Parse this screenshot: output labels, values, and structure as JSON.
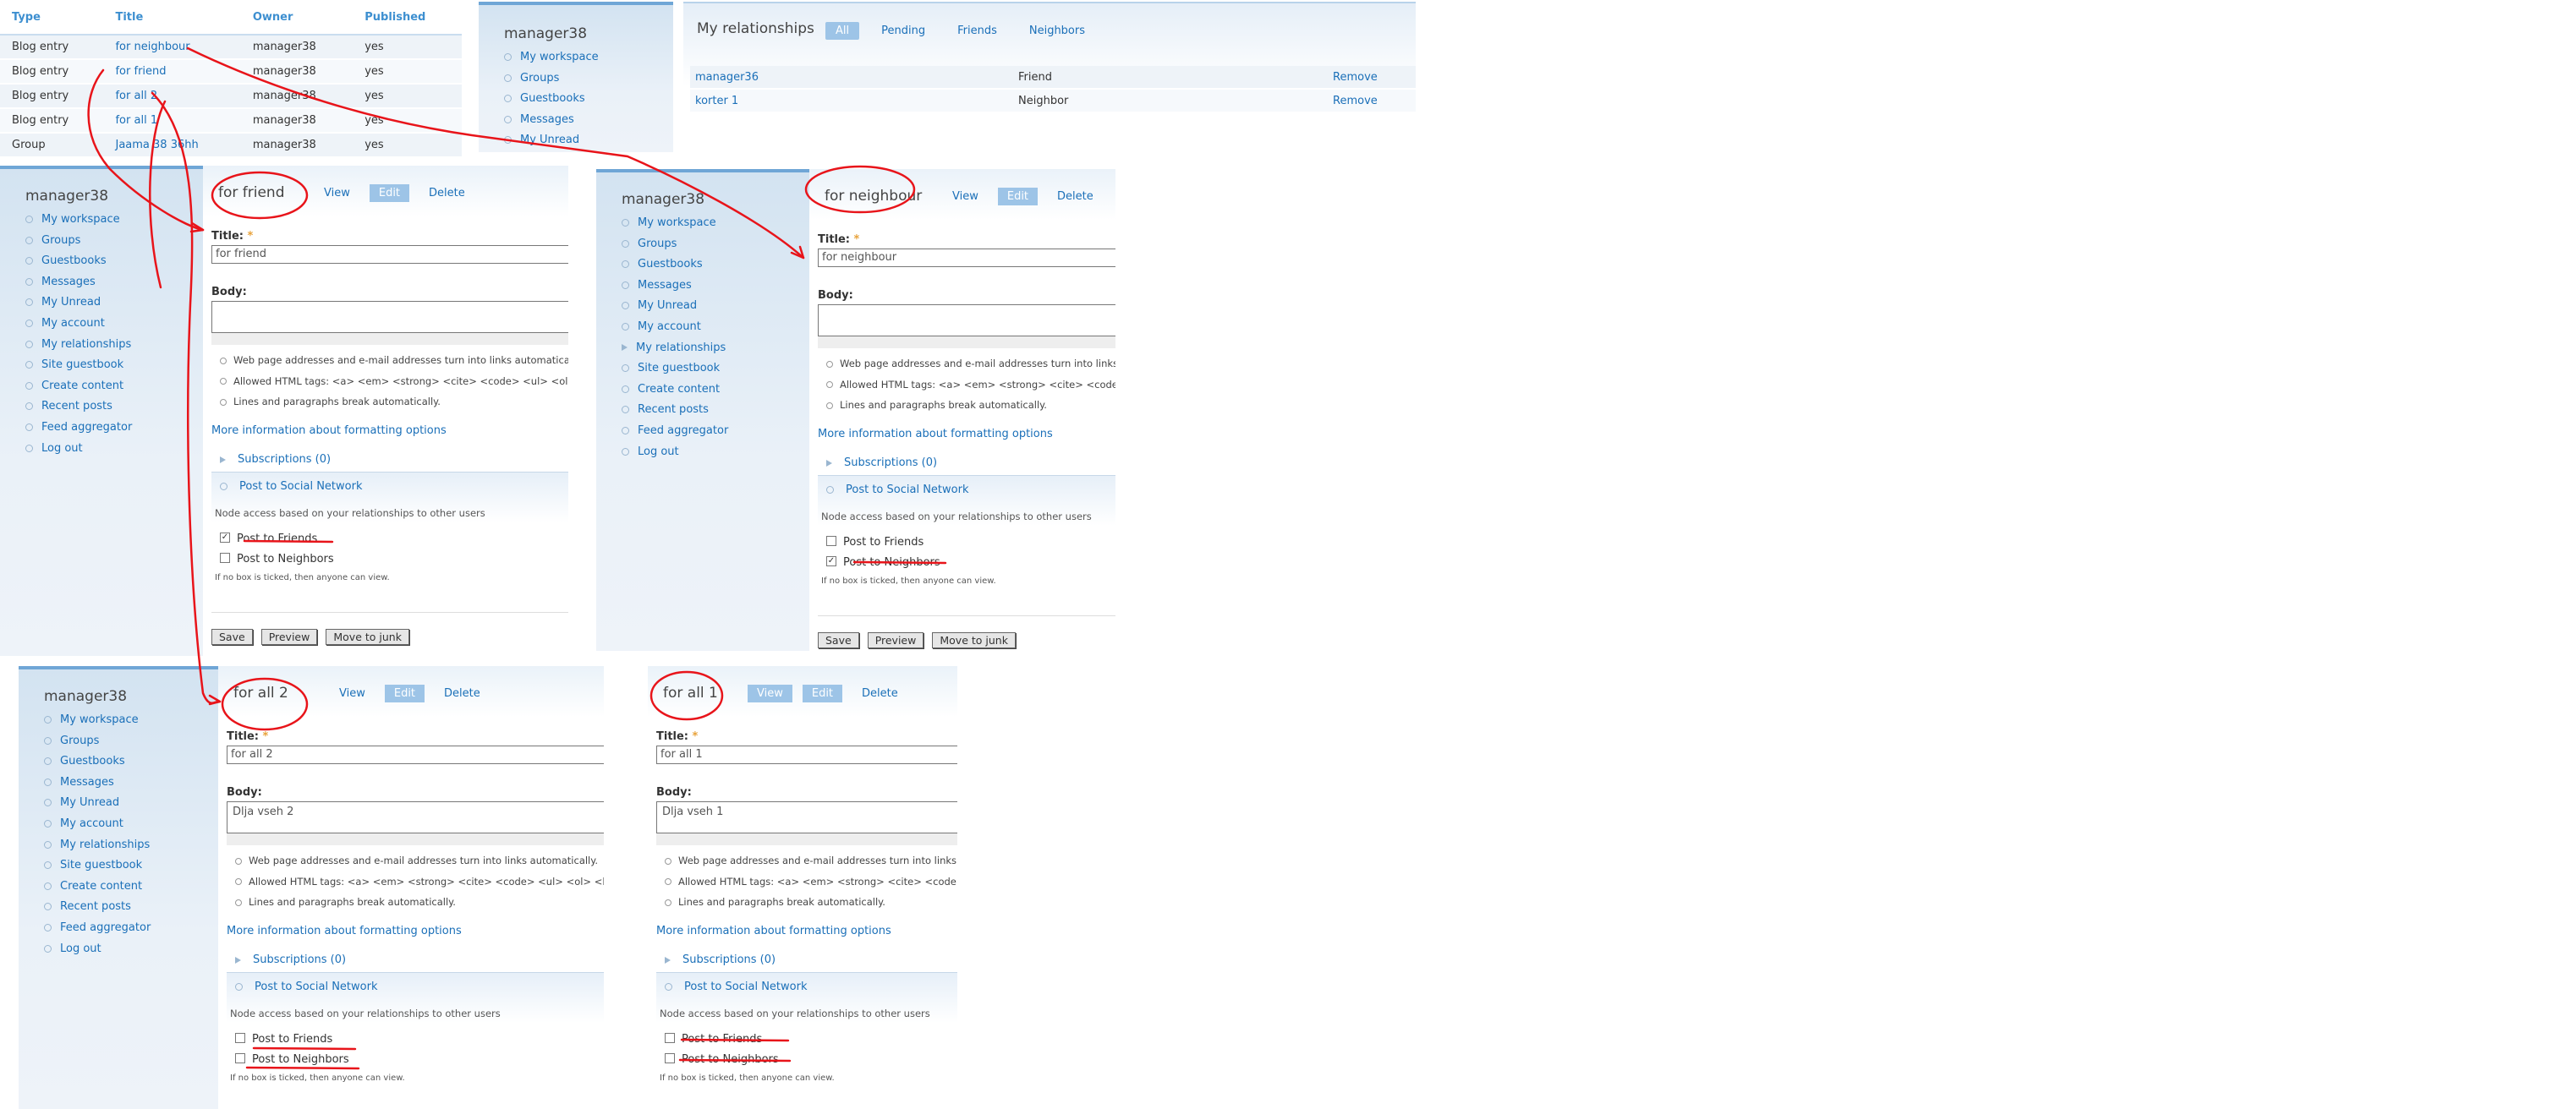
{
  "node_table": {
    "headers": [
      "Type",
      "Title",
      "Owner",
      "Published"
    ],
    "rows": [
      {
        "type": "Blog entry",
        "title": "for neighbour",
        "owner": "manager38",
        "published": "yes"
      },
      {
        "type": "Blog entry",
        "title": "for friend",
        "owner": "manager38",
        "published": "yes"
      },
      {
        "type": "Blog entry",
        "title": "for all 2",
        "owner": "manager38",
        "published": "yes"
      },
      {
        "type": "Blog entry",
        "title": "for all 1",
        "owner": "manager38",
        "published": "yes"
      },
      {
        "type": "Group",
        "title": "Jaama 38 36hh",
        "owner": "manager38",
        "published": "yes"
      }
    ]
  },
  "sidebar_short": {
    "username": "manager38",
    "items": [
      "My workspace",
      "Groups",
      "Guestbooks",
      "Messages",
      "My Unread"
    ]
  },
  "sidebar_full": {
    "username": "manager38",
    "items": [
      "My workspace",
      "Groups",
      "Guestbooks",
      "Messages",
      "My Unread",
      "My account",
      "My relationships",
      "Site guestbook",
      "Create content",
      "Recent posts",
      "Feed aggregator",
      "Log out"
    ]
  },
  "relationships": {
    "title": "My relationships",
    "tabs": [
      "All",
      "Pending",
      "Friends",
      "Neighbors"
    ],
    "rows": [
      {
        "name": "manager36",
        "type": "Friend",
        "action": "Remove"
      },
      {
        "name": "korter 1",
        "type": "Neighbor",
        "action": "Remove"
      }
    ]
  },
  "form_common": {
    "tabs": [
      "View",
      "Edit",
      "Delete"
    ],
    "title_label": "Title:",
    "required_mark": "*",
    "body_label": "Body:",
    "tips": [
      "Web page addresses and e-mail addresses turn into links automatically.",
      "Allowed HTML tags: <a> <em> <strong> <cite> <code> <ul> <ol> <li> <dl> <dt> <dd>",
      "Lines and paragraphs break automatically."
    ],
    "more_info": "More information about formatting options",
    "subscriptions": "Subscriptions (0)",
    "social": "Post to Social Network",
    "social_desc": "Node access based on your relationships to other users",
    "post_friends": "Post to Friends",
    "post_neighbors": "Post to Neighbors",
    "hint": "If no box is ticked, then anyone can view.",
    "buttons": [
      "Save",
      "Preview",
      "Move to junk"
    ],
    "check_mark": "✓"
  },
  "forms": [
    {
      "heading": "for friend",
      "title_value": "for friend",
      "body_value": "",
      "friends_checked": true,
      "neighbors_checked": false
    },
    {
      "heading": "for neighbour",
      "title_value": "for neighbour",
      "body_value": "",
      "friends_checked": false,
      "neighbors_checked": true
    },
    {
      "heading": "for all 2",
      "title_value": "for all 2",
      "body_value": "Dlja vseh 2",
      "friends_checked": false,
      "neighbors_checked": false
    },
    {
      "heading": "for all 1",
      "title_value": "for all 1",
      "body_value": "Dlja vseh 1",
      "friends_checked": false,
      "neighbors_checked": false
    }
  ],
  "colors": {
    "link": "#1a6fb8",
    "header": "#3d8fd0",
    "tab_active": "#9dc4e7",
    "annotation": "#e8141a"
  }
}
